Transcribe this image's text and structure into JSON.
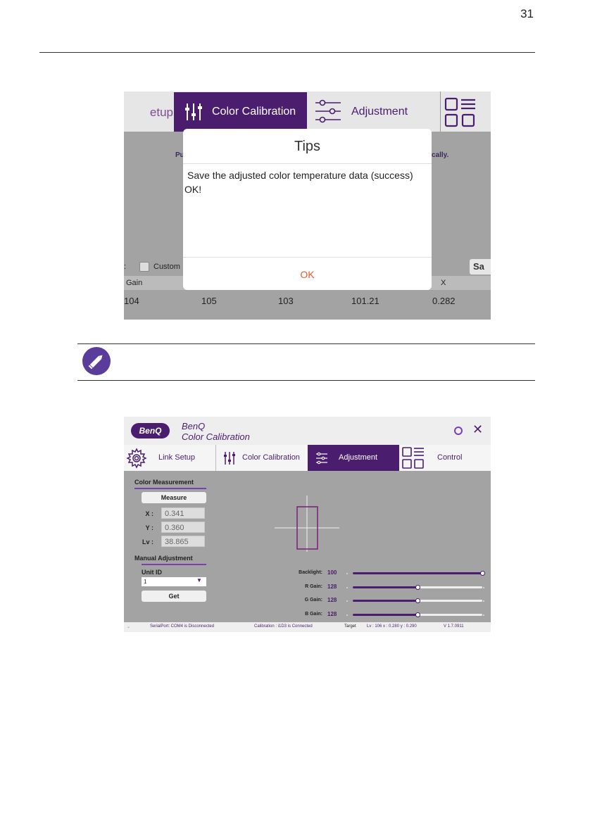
{
  "page_number": "31",
  "screenshot1": {
    "tabs": {
      "setup": "etup",
      "color_calibration": "Color Calibration",
      "adjustment": "Adjustment"
    },
    "background_left_text": "Pu",
    "background_right_text": "cally.",
    "custom_label": "Custom",
    "save_partial": "Sa",
    "table_header_gain": "Gain",
    "table_header_x": "X",
    "row": [
      "104",
      "105",
      "103",
      "101.21",
      "0.282"
    ],
    "dialog": {
      "title": "Tips",
      "message": "Save the adjusted color temperature data (success)",
      "result": "OK!",
      "ok_button": "OK"
    }
  },
  "screenshot2": {
    "logo": "BenQ",
    "title_line1": "BenQ",
    "title_line2": "Color Calibration",
    "tabs": [
      {
        "label": "Link Setup"
      },
      {
        "label": "Color Calibration"
      },
      {
        "label": "Adjustment"
      },
      {
        "label": "Control"
      }
    ],
    "color_measurement": {
      "title": "Color Measurement",
      "measure_button": "Measure",
      "x_label": "X :",
      "x_value": "0.341",
      "y_label": "Y :",
      "y_value": "0.360",
      "lv_label": "Lv :",
      "lv_value": "38.865"
    },
    "manual_adjustment": {
      "title": "Manual Adjustment",
      "unit_id_label": "Unit ID",
      "unit_id_value": "1",
      "get_button": "Get"
    },
    "sliders": [
      {
        "label": "Backlight:",
        "value": "100",
        "fraction": 1.0
      },
      {
        "label": "R Gain:",
        "value": "128",
        "fraction": 0.5
      },
      {
        "label": "G Gain:",
        "value": "128",
        "fraction": 0.5
      },
      {
        "label": "B Gain:",
        "value": "128",
        "fraction": 0.5
      }
    ],
    "status": {
      "serial": "SerialPort: COM4 is Disconnected",
      "calibration": "Calibration : i1D3 is Connected",
      "target": "Target",
      "target_values": "Lv : 106 x : 0.280 y : 0.290",
      "version": "V 1.7.0911"
    }
  },
  "colors": {
    "brand_purple": "#4b1d6e",
    "accent_orange": "#e5572d",
    "note_icon": "#5a3d9a"
  }
}
